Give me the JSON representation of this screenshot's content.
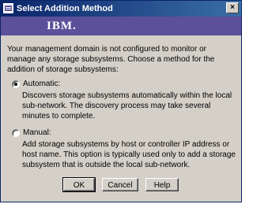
{
  "window": {
    "title": "Select Addition Method",
    "close_glyph": "×"
  },
  "banner": {
    "logo_text": "IBM."
  },
  "dialog": {
    "intro": "Your management domain is not configured to monitor or manage any storage subsystems. Choose a method for the addition of storage subsystems:",
    "options": [
      {
        "label": "Automatic:",
        "selected": true,
        "description": "Discovers storage subsystems automatically within the local sub-network. The discovery process may take several minutes to complete."
      },
      {
        "label": "Manual:",
        "selected": false,
        "description": "Add storage subsystems by host or controller IP address or host name. This option is typically used only to add a storage subsystem that is outside the local sub-network."
      }
    ]
  },
  "buttons": {
    "ok": "OK",
    "cancel": "Cancel",
    "help": "Help"
  },
  "colors": {
    "title_bar": "#0a246a",
    "banner": "#5c509a",
    "dialog_bg": "#d4d0c8"
  }
}
